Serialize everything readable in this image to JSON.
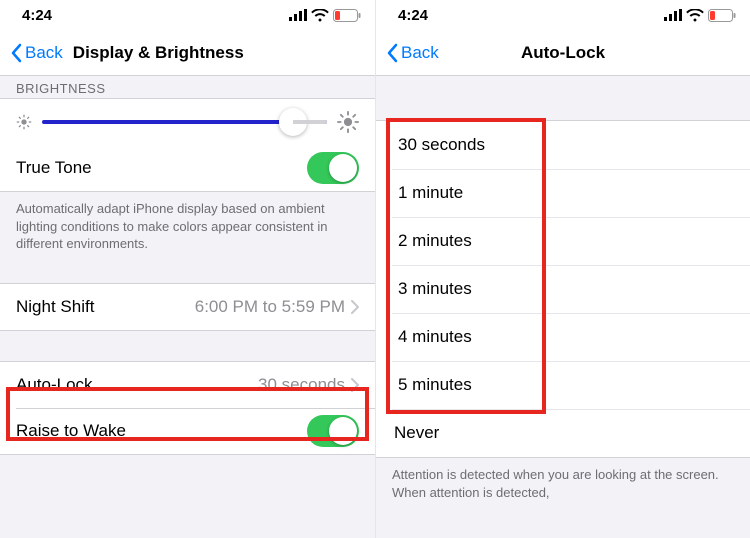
{
  "status": {
    "time": "4:24"
  },
  "nav": {
    "back": "Back",
    "title_left": "Display & Brightness",
    "title_right": "Auto-Lock"
  },
  "left": {
    "section_cut": "BRIGHTNESS",
    "true_tone": "True Tone",
    "true_tone_note": "Automatically adapt iPhone display based on ambient lighting conditions to make colors appear consistent in different environments.",
    "night_shift": {
      "label": "Night Shift",
      "detail": "6:00 PM to 5:59 PM"
    },
    "auto_lock": {
      "label": "Auto-Lock",
      "detail": "30 seconds"
    },
    "raise_to_wake": "Raise to Wake"
  },
  "right": {
    "options": [
      "30 seconds",
      "1 minute",
      "2 minutes",
      "3 minutes",
      "4 minutes",
      "5 minutes",
      "Never"
    ],
    "note": "Attention is detected when you are looking at the screen. When attention is detected,"
  }
}
